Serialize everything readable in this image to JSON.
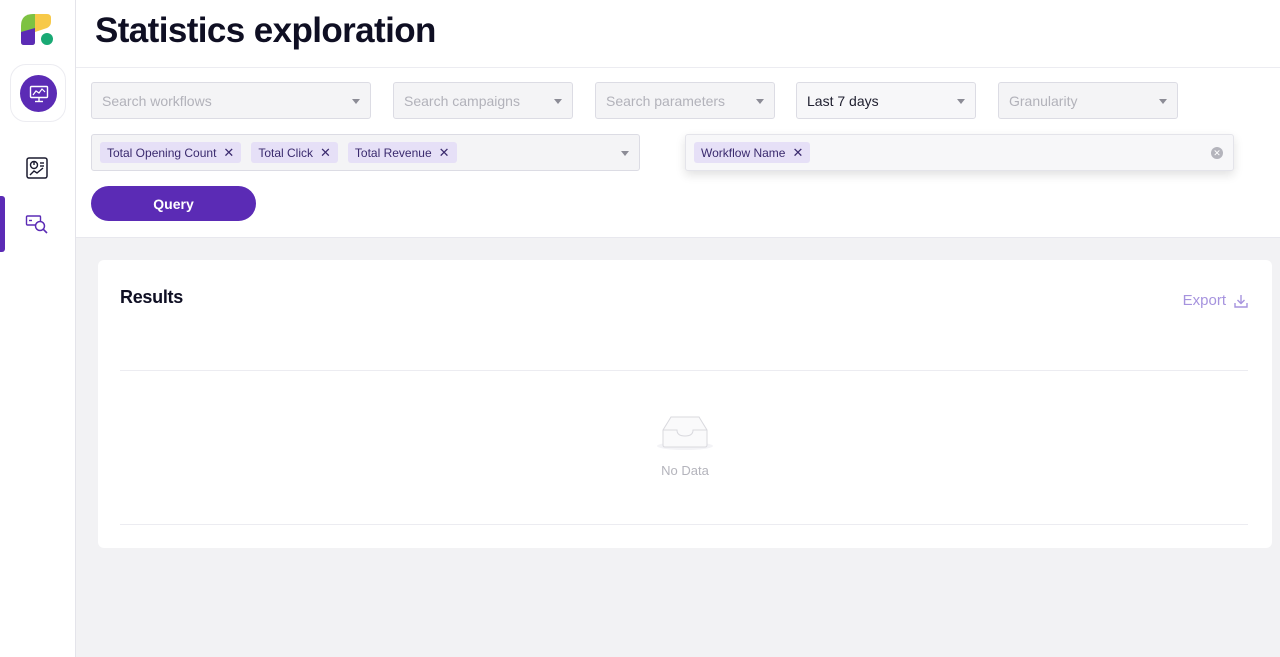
{
  "header": {
    "title": "Statistics exploration"
  },
  "sidebar": {
    "items": [
      {
        "icon": "dashboard-chart-icon",
        "active": false
      },
      {
        "icon": "search-explore-icon",
        "active": true
      }
    ]
  },
  "filters": {
    "workflows": {
      "placeholder": "Search workflows"
    },
    "campaigns": {
      "placeholder": "Search campaigns"
    },
    "parameters": {
      "placeholder": "Search parameters"
    },
    "period": {
      "value": "Last 7 days"
    },
    "granularity": {
      "placeholder": "Granularity"
    },
    "metrics": [
      "Total Opening Count",
      "Total Click",
      "Total Revenue"
    ],
    "groupby": [
      "Workflow Name"
    ]
  },
  "actions": {
    "query_label": "Query"
  },
  "results": {
    "title": "Results",
    "export_label": "Export",
    "empty_text": "No Data"
  },
  "colors": {
    "accent": "#5b2bb5",
    "tag_bg": "#e6e0f7",
    "export": "#a693de"
  }
}
